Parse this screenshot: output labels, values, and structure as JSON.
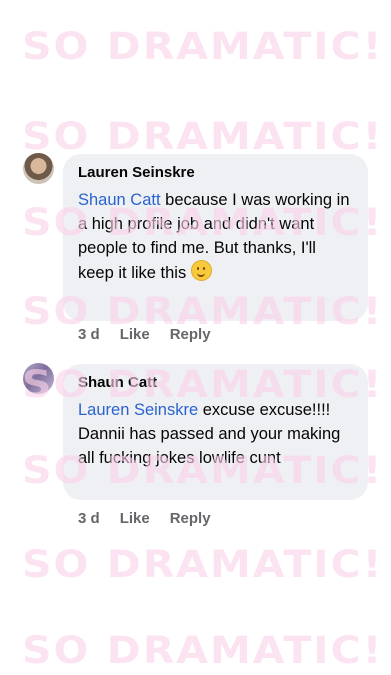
{
  "watermark": "SO DRAMATIC!",
  "comments": [
    {
      "author": "Lauren Seinskre",
      "mention": "Shaun Catt",
      "text": " because I was working in a high profile job and didn't want people to find me. But thanks, I'll keep it like this ",
      "emoji": "slightly-smiling-face",
      "time": "3 d",
      "like": "Like",
      "reply": "Reply"
    },
    {
      "author": "Shaun Catt",
      "mention": "Lauren Seinskre",
      "text": " excuse excuse!!!! Dannii has passed and your making all fucking jokes lowlife cunt",
      "time": "3 d",
      "like": "Like",
      "reply": "Reply"
    }
  ],
  "colors": {
    "mention": "#2a63cf",
    "bubble": "#eff0f3",
    "watermark": "#fbd3ea",
    "meta": "#65676b"
  }
}
